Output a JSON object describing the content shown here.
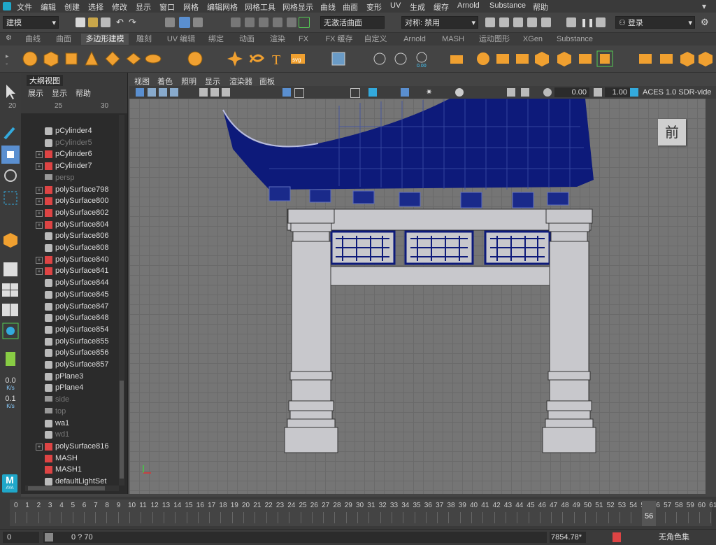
{
  "menubar": {
    "items": [
      "文件",
      "编辑",
      "创建",
      "选择",
      "修改",
      "显示",
      "窗口",
      "网格",
      "编辑网格",
      "网格工具",
      "网格显示",
      "曲线",
      "曲面",
      "变形",
      "UV",
      "生成",
      "缓存",
      "Arnold",
      "Substance",
      "帮助"
    ]
  },
  "status": {
    "mode": "建模",
    "live_surface": "无激活曲面",
    "symmetry": "对称: 禁用",
    "login": "登录"
  },
  "shelf_tabs": [
    "曲线",
    "曲面",
    "多边形建模",
    "雕刻",
    "UV 编辑",
    "绑定",
    "动画",
    "渲染",
    "FX",
    "FX 缓存",
    "自定义",
    "Arnold",
    "MASH",
    "运动图形",
    "XGen",
    "Substance"
  ],
  "shelf_active": "多边形建模",
  "outliner": {
    "title": "大纲视图",
    "menu": [
      "展示",
      "显示",
      "帮助"
    ],
    "ruler": [
      "20",
      "25",
      "30"
    ],
    "items": [
      {
        "label": "pCylinder4",
        "dim": false,
        "expand": false,
        "type": "mesh"
      },
      {
        "label": "pCylinder5",
        "dim": true,
        "expand": false,
        "type": "mesh"
      },
      {
        "label": "pCylinder6",
        "dim": false,
        "expand": true,
        "type": "group"
      },
      {
        "label": "pCylinder7",
        "dim": false,
        "expand": true,
        "type": "group"
      },
      {
        "label": "persp",
        "dim": true,
        "expand": false,
        "type": "camera"
      },
      {
        "label": "polySurface798",
        "dim": false,
        "expand": true,
        "type": "group"
      },
      {
        "label": "polySurface800",
        "dim": false,
        "expand": true,
        "type": "group"
      },
      {
        "label": "polySurface802",
        "dim": false,
        "expand": true,
        "type": "group"
      },
      {
        "label": "polySurface804",
        "dim": false,
        "expand": true,
        "type": "group"
      },
      {
        "label": "polySurface806",
        "dim": false,
        "expand": false,
        "type": "mesh"
      },
      {
        "label": "polySurface808",
        "dim": false,
        "expand": false,
        "type": "mesh"
      },
      {
        "label": "polySurface840",
        "dim": false,
        "expand": true,
        "type": "group"
      },
      {
        "label": "polySurface841",
        "dim": false,
        "expand": true,
        "type": "group"
      },
      {
        "label": "polySurface844",
        "dim": false,
        "expand": false,
        "type": "mesh"
      },
      {
        "label": "polySurface845",
        "dim": false,
        "expand": false,
        "type": "mesh"
      },
      {
        "label": "polySurface847",
        "dim": false,
        "expand": false,
        "type": "mesh"
      },
      {
        "label": "polySurface848",
        "dim": false,
        "expand": false,
        "type": "mesh"
      },
      {
        "label": "polySurface854",
        "dim": false,
        "expand": false,
        "type": "mesh"
      },
      {
        "label": "polySurface855",
        "dim": false,
        "expand": false,
        "type": "mesh"
      },
      {
        "label": "polySurface856",
        "dim": false,
        "expand": false,
        "type": "mesh"
      },
      {
        "label": "polySurface857",
        "dim": false,
        "expand": false,
        "type": "mesh"
      },
      {
        "label": "pPlane3",
        "dim": false,
        "expand": false,
        "type": "mesh"
      },
      {
        "label": "pPlane4",
        "dim": false,
        "expand": false,
        "type": "mesh"
      },
      {
        "label": "side",
        "dim": true,
        "expand": false,
        "type": "camera"
      },
      {
        "label": "top",
        "dim": true,
        "expand": false,
        "type": "camera"
      },
      {
        "label": "wa1",
        "dim": false,
        "expand": false,
        "type": "mesh"
      },
      {
        "label": "wd1",
        "dim": true,
        "expand": false,
        "type": "mesh"
      },
      {
        "label": "polySurface816",
        "dim": false,
        "expand": true,
        "type": "group"
      },
      {
        "label": "MASH",
        "dim": false,
        "expand": false,
        "type": "mash"
      },
      {
        "label": "MASH1",
        "dim": false,
        "expand": false,
        "type": "mash"
      },
      {
        "label": "defaultLightSet",
        "dim": false,
        "expand": false,
        "type": "set"
      }
    ]
  },
  "toolbox": {
    "rate1": "0.0",
    "rate2": "0.1",
    "rate_unit": "K/s",
    "maya_label": "M",
    "maya_sub": "AYA"
  },
  "viewport": {
    "menu": [
      "视图",
      "着色",
      "照明",
      "显示",
      "渲染器",
      "面板"
    ],
    "exposure": "0.00",
    "gamma": "1.00",
    "color_space": "ACES 1.0 SDR-vide",
    "view_label": "前"
  },
  "timeline": {
    "ticks": [
      "0",
      "1",
      "2",
      "3",
      "4",
      "5",
      "6",
      "7",
      "8",
      "9",
      "10",
      "11",
      "12",
      "13",
      "14",
      "15",
      "16",
      "17",
      "18",
      "19",
      "20",
      "21",
      "22",
      "23",
      "24",
      "25",
      "26",
      "27",
      "28",
      "29",
      "30",
      "31",
      "32",
      "33",
      "34",
      "35",
      "36",
      "37",
      "38",
      "39",
      "40",
      "41",
      "42",
      "43",
      "44",
      "45",
      "46",
      "47",
      "48",
      "49",
      "50",
      "51",
      "52",
      "53",
      "54",
      "55",
      "56",
      "57",
      "58",
      "59",
      "60",
      "61"
    ],
    "current_frame": "56"
  },
  "range": {
    "start": "0",
    "slider_text": "0 ? 70",
    "memory": "7854.78*",
    "character_set": "无角色集"
  },
  "colors": {
    "wire": "#0d1a7a",
    "stone": "#c8c8cc",
    "viewport_bg": "#757575",
    "accent_orange": "#f0a030"
  }
}
